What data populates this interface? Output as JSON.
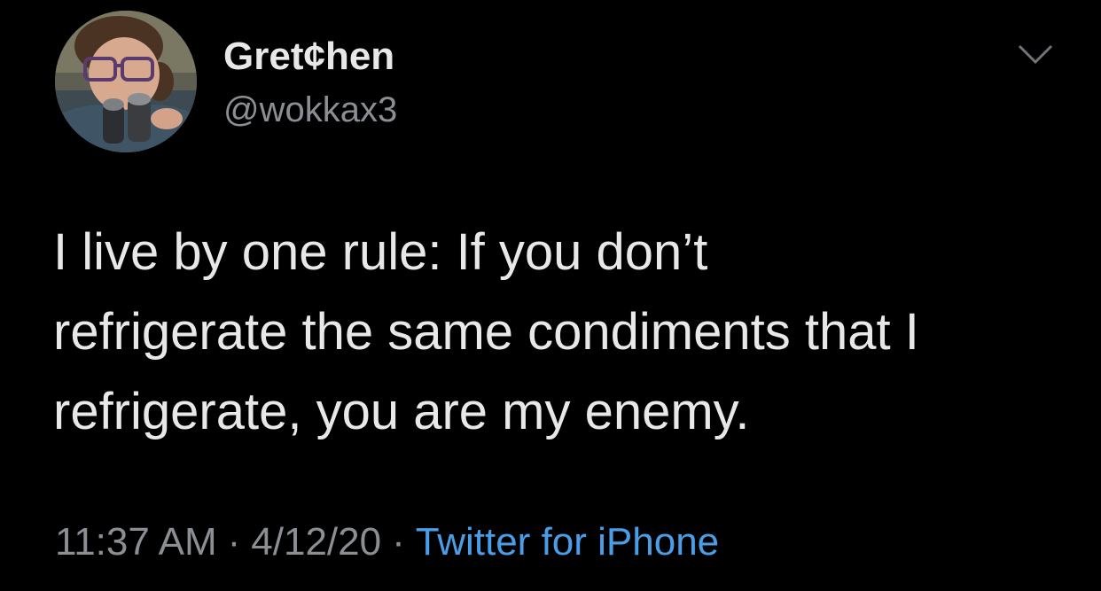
{
  "user": {
    "display_name": "Gret¢hen",
    "handle": "@wokkax3"
  },
  "tweet": {
    "lines": [
      "I live by one rule: If you don’t",
      "refrigerate the same condiments that I",
      "refrigerate, you are my enemy."
    ]
  },
  "meta": {
    "time": "11:37 AM",
    "separator": "·",
    "date": "4/12/20",
    "source": "Twitter for iPhone"
  },
  "colors": {
    "background": "#000000",
    "text": "#e8e8e8",
    "secondary": "#8b8f94",
    "link": "#4a9ee8"
  },
  "icons": {
    "menu": "chevron-down-icon"
  }
}
